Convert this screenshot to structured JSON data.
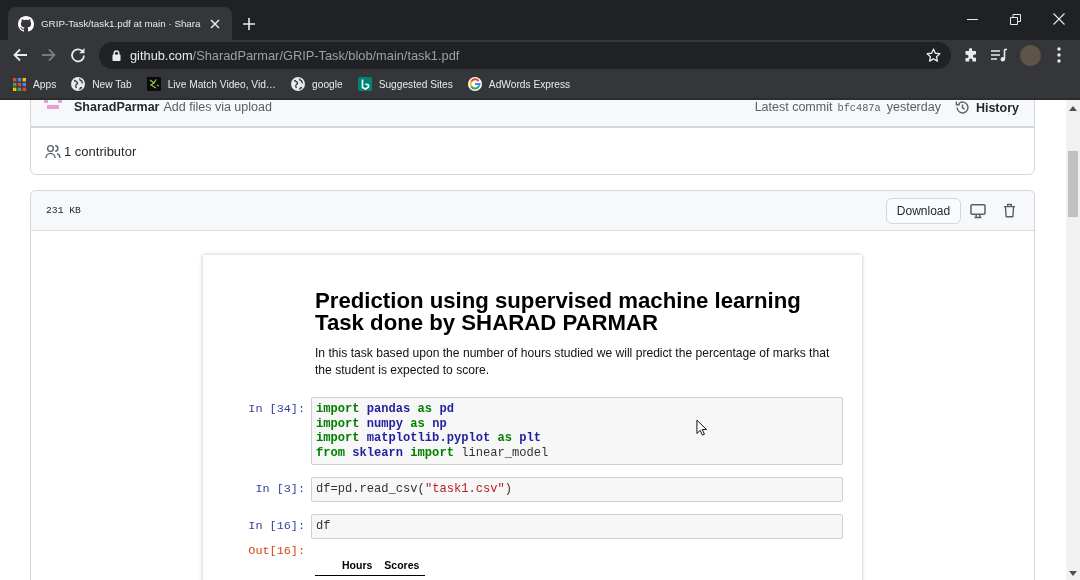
{
  "browser": {
    "tabs": [
      {
        "title": "GRIP-Task/task1.pdf at main · Shara",
        "selected": true
      }
    ],
    "nav_buttons": [
      {
        "kind": "back",
        "disabled": false
      },
      {
        "kind": "forward",
        "disabled": true
      },
      {
        "kind": "reload",
        "disabled": false
      }
    ],
    "address": {
      "host": "github.com",
      "path": "/SharadParmar/GRIP-Task/blob/main/task1.pdf"
    },
    "bookmarks": [
      {
        "kind": "apps",
        "label": "Apps"
      },
      {
        "kind": "globe",
        "label": "New Tab"
      },
      {
        "kind": "squiggle",
        "label": "Live Match Video, Vid…"
      },
      {
        "kind": "globe",
        "label": "google"
      },
      {
        "kind": "tile",
        "label": "Suggested Sites"
      },
      {
        "kind": "ring",
        "label": "AdWords Express"
      }
    ]
  },
  "commit": {
    "author": "SharadParmar",
    "message": "Add files via upload",
    "latest_label": "Latest commit",
    "sha": "bfc487a",
    "time": "yesterday",
    "history": "History"
  },
  "contributors": {
    "label": "1 contributor"
  },
  "file": {
    "size": "231 KB",
    "download": "Download"
  },
  "notebook": {
    "title_lines": [
      "Prediction using supervised machine learning",
      "Task done by SHARAD PARMAR"
    ],
    "intro": "In this task based upon the number of hours studied we will predict the percentage of marks that the student is expected to score.",
    "cells": [
      {
        "prompt": "In [34]:",
        "lines": [
          [
            {
              "kind": "keyword",
              "text": "import"
            },
            {
              "kind": "module",
              "text": " pandas"
            },
            {
              "kind": "keyword",
              "text": " as"
            },
            {
              "kind": "module",
              "text": " pd"
            }
          ],
          [
            {
              "kind": "keyword",
              "text": "import"
            },
            {
              "kind": "module",
              "text": " numpy"
            },
            {
              "kind": "keyword",
              "text": " as"
            },
            {
              "kind": "module",
              "text": " np"
            }
          ],
          [
            {
              "kind": "keyword",
              "text": "import"
            },
            {
              "kind": "module",
              "text": " matplotlib.pyplot"
            },
            {
              "kind": "keyword",
              "text": " as"
            },
            {
              "kind": "module",
              "text": " plt"
            }
          ],
          [
            {
              "kind": "keyword",
              "text": "from"
            },
            {
              "kind": "module",
              "text": " sklearn"
            },
            {
              "kind": "keyword",
              "text": " import"
            },
            {
              "kind": "plain",
              "text": " linear_model"
            }
          ]
        ]
      },
      {
        "prompt": "In [3]:",
        "lines": [
          [
            {
              "kind": "plain",
              "text": "df=pd.read_csv("
            },
            {
              "kind": "string",
              "text": "\"task1.csv\""
            },
            {
              "kind": "plain",
              "text": ")"
            }
          ]
        ]
      },
      {
        "prompt": "In [16]:",
        "lines": [
          [
            {
              "kind": "plain",
              "text": "df"
            }
          ]
        ]
      }
    ],
    "output": {
      "prompt": "Out[16]:",
      "columns": [
        "Hours",
        "Scores"
      ]
    }
  }
}
